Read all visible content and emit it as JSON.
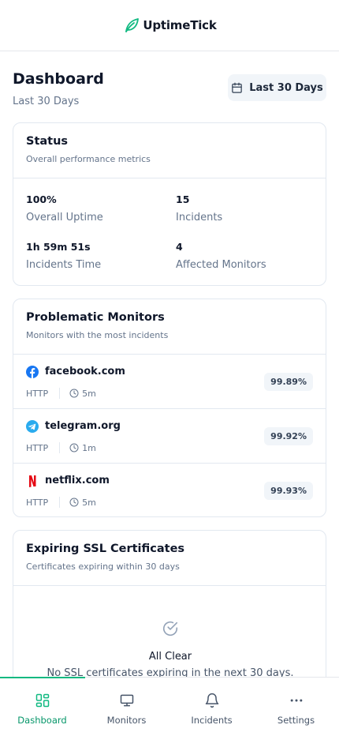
{
  "app": {
    "name": "UptimeTick",
    "accent": "#10b981"
  },
  "page": {
    "title": "Dashboard",
    "subtitle": "Last 30 Days",
    "range_label": "Last 30 Days"
  },
  "status": {
    "title": "Status",
    "subtitle": "Overall performance metrics",
    "metrics": [
      {
        "value": "100%",
        "label": "Overall Uptime"
      },
      {
        "value": "15",
        "label": "Incidents"
      },
      {
        "value": "1h 59m 51s",
        "label": "Incidents Time"
      },
      {
        "value": "4",
        "label": "Affected Monitors"
      }
    ]
  },
  "problematic": {
    "title": "Problematic Monitors",
    "subtitle": "Monitors with the most incidents",
    "monitors": [
      {
        "name": "facebook.com",
        "type": "HTTP",
        "interval": "5m",
        "uptime": "99.89%",
        "icon": "facebook-icon"
      },
      {
        "name": "telegram.org",
        "type": "HTTP",
        "interval": "1m",
        "uptime": "99.92%",
        "icon": "telegram-icon"
      },
      {
        "name": "netflix.com",
        "type": "HTTP",
        "interval": "5m",
        "uptime": "99.93%",
        "icon": "netflix-icon"
      }
    ]
  },
  "ssl": {
    "title": "Expiring SSL Certificates",
    "subtitle": "Certificates expiring within 30 days",
    "empty_title": "All Clear",
    "empty_text": "No SSL certificates expiring in the next 30 days."
  },
  "nav": {
    "items": [
      {
        "label": "Dashboard",
        "icon": "dashboard-icon",
        "active": true
      },
      {
        "label": "Monitors",
        "icon": "monitor-icon",
        "active": false
      },
      {
        "label": "Incidents",
        "icon": "bell-icon",
        "active": false
      },
      {
        "label": "Settings",
        "icon": "more-icon",
        "active": false
      }
    ]
  }
}
